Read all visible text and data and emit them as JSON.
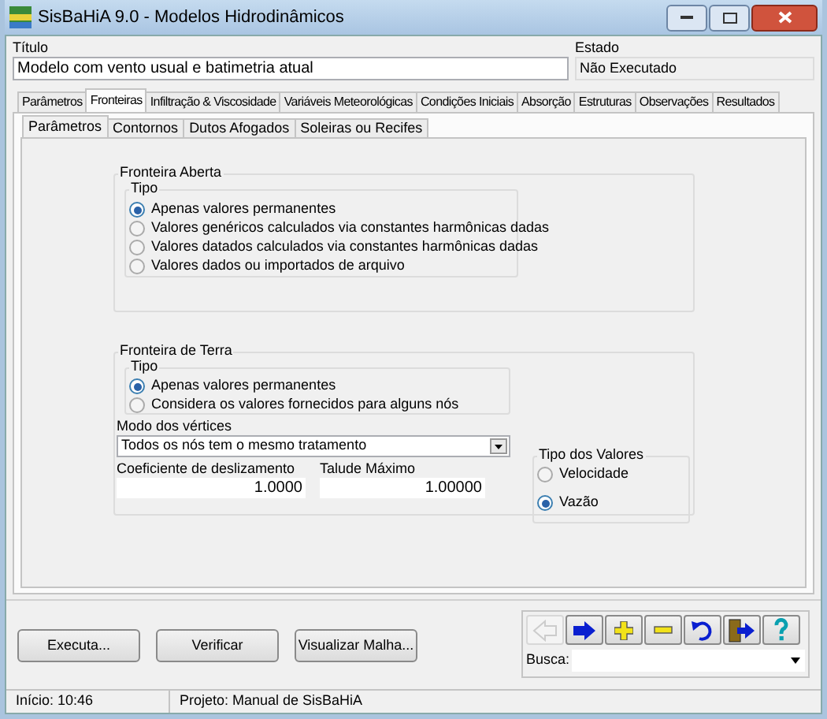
{
  "window": {
    "title": "SisBaHiA 9.0 - Modelos Hidrodinâmicos"
  },
  "title_field": {
    "label": "Título",
    "value": "Modelo com vento usual e batimetria atual"
  },
  "state_field": {
    "label": "Estado",
    "value": "Não Executado"
  },
  "tabs": [
    {
      "label": "Parâmetros",
      "selected": false
    },
    {
      "label": "Fronteiras",
      "selected": true
    },
    {
      "label": "Infiltração & Viscosidade",
      "selected": false
    },
    {
      "label": "Variáveis Meteorológicas",
      "selected": false
    },
    {
      "label": "Condições Iniciais",
      "selected": false
    },
    {
      "label": "Absorção",
      "selected": false
    },
    {
      "label": "Estruturas",
      "selected": false
    },
    {
      "label": "Observações",
      "selected": false
    },
    {
      "label": "Resultados",
      "selected": false
    }
  ],
  "subtabs": [
    {
      "label": "Parâmetros",
      "selected": true
    },
    {
      "label": "Contornos",
      "selected": false
    },
    {
      "label": "Dutos Afogados",
      "selected": false
    },
    {
      "label": "Soleiras ou Recifes",
      "selected": false
    }
  ],
  "open_boundary": {
    "title": "Fronteira Aberta",
    "type_title": "Tipo",
    "options": [
      {
        "label": "Apenas valores permanentes",
        "selected": true
      },
      {
        "label": "Valores genéricos calculados via constantes harmônicas dadas",
        "selected": false
      },
      {
        "label": "Valores datados calculados via constantes harmônicas dadas",
        "selected": false
      },
      {
        "label": "Valores dados ou importados de arquivo",
        "selected": false
      }
    ]
  },
  "land_boundary": {
    "title": "Fronteira de Terra",
    "type_title": "Tipo",
    "options": [
      {
        "label": "Apenas valores permanentes",
        "selected": true
      },
      {
        "label": "Considera os valores fornecidos para alguns nós",
        "selected": false
      }
    ],
    "vertex_mode": {
      "label": "Modo dos vértices",
      "value": "Todos os nós tem o mesmo tratamento"
    },
    "slip_coefficient": {
      "label": "Coeficiente de deslizamento",
      "value": "1.0000"
    },
    "max_slope": {
      "label": "Talude Máximo",
      "value": "1.00000"
    },
    "value_type": {
      "title": "Tipo dos Valores",
      "options": [
        {
          "label": "Velocidade",
          "selected": false
        },
        {
          "label": "Vazão",
          "selected": true
        }
      ]
    }
  },
  "buttons": [
    "Executa...",
    "Verificar",
    "Visualizar Malha..."
  ],
  "toolbar": [
    {
      "kind": "back",
      "disabled": true
    },
    {
      "kind": "forward",
      "disabled": false
    },
    {
      "kind": "add",
      "disabled": false
    },
    {
      "kind": "remove",
      "disabled": false
    },
    {
      "kind": "undo",
      "disabled": false
    },
    {
      "kind": "exit",
      "disabled": false
    },
    {
      "kind": "help",
      "disabled": false
    }
  ],
  "search": {
    "label": "Busca:"
  },
  "status_bar": [
    "Início: 10:46",
    "Projeto: Manual de SisBaHiA"
  ]
}
